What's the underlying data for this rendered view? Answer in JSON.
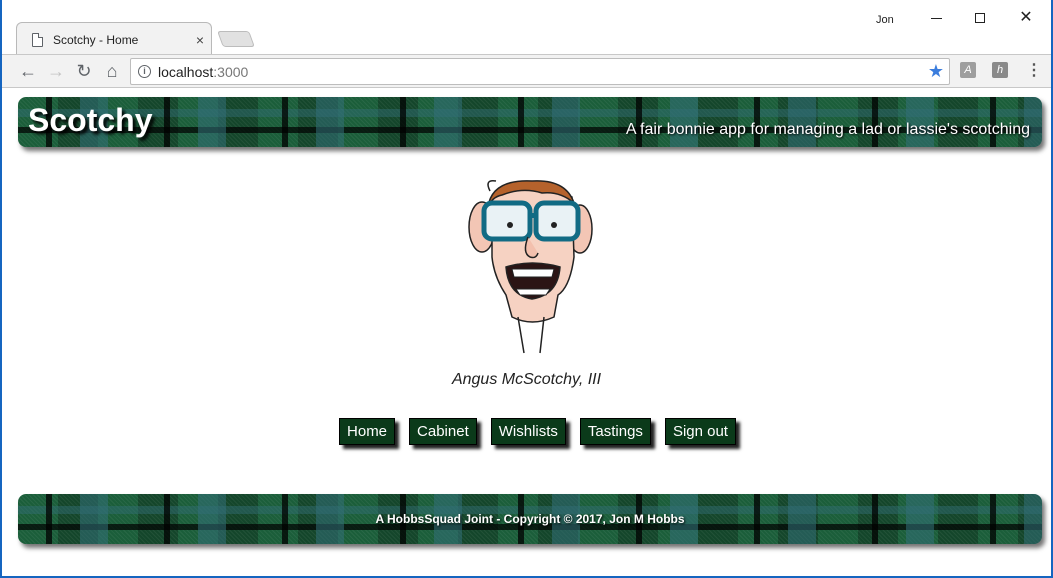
{
  "browser": {
    "tab_title": "Scotchy - Home",
    "tab_close": "×",
    "user": "Jon",
    "controls": {
      "minimize": "",
      "maximize": "",
      "close": "✕"
    },
    "url_host": "localhost",
    "url_port": ":3000",
    "nav": {
      "back": "←",
      "forward": "→",
      "reload": "↻",
      "home": "⌂"
    },
    "info_icon_glyph": "i",
    "star_glyph": "★",
    "ext_pdf_glyph": "A",
    "ext_h_glyph": "h",
    "menu_glyph": "⋮",
    "accent": "#3b7ddd"
  },
  "header": {
    "brand": "Scotchy",
    "tagline": "A fair bonnie app for managing a lad or lassie's scotching"
  },
  "profile": {
    "name": "Angus McScotchy, III"
  },
  "nav": {
    "items": [
      {
        "label": "Home"
      },
      {
        "label": "Cabinet"
      },
      {
        "label": "Wishlists"
      },
      {
        "label": "Tastings"
      },
      {
        "label": "Sign out"
      }
    ]
  },
  "footer": {
    "text": "A HobbsSquad Joint - Copyright © 2017, Jon M Hobbs"
  },
  "colors": {
    "tartan_green": "#1b5e3a",
    "nav_button": "#0b3a1a"
  }
}
